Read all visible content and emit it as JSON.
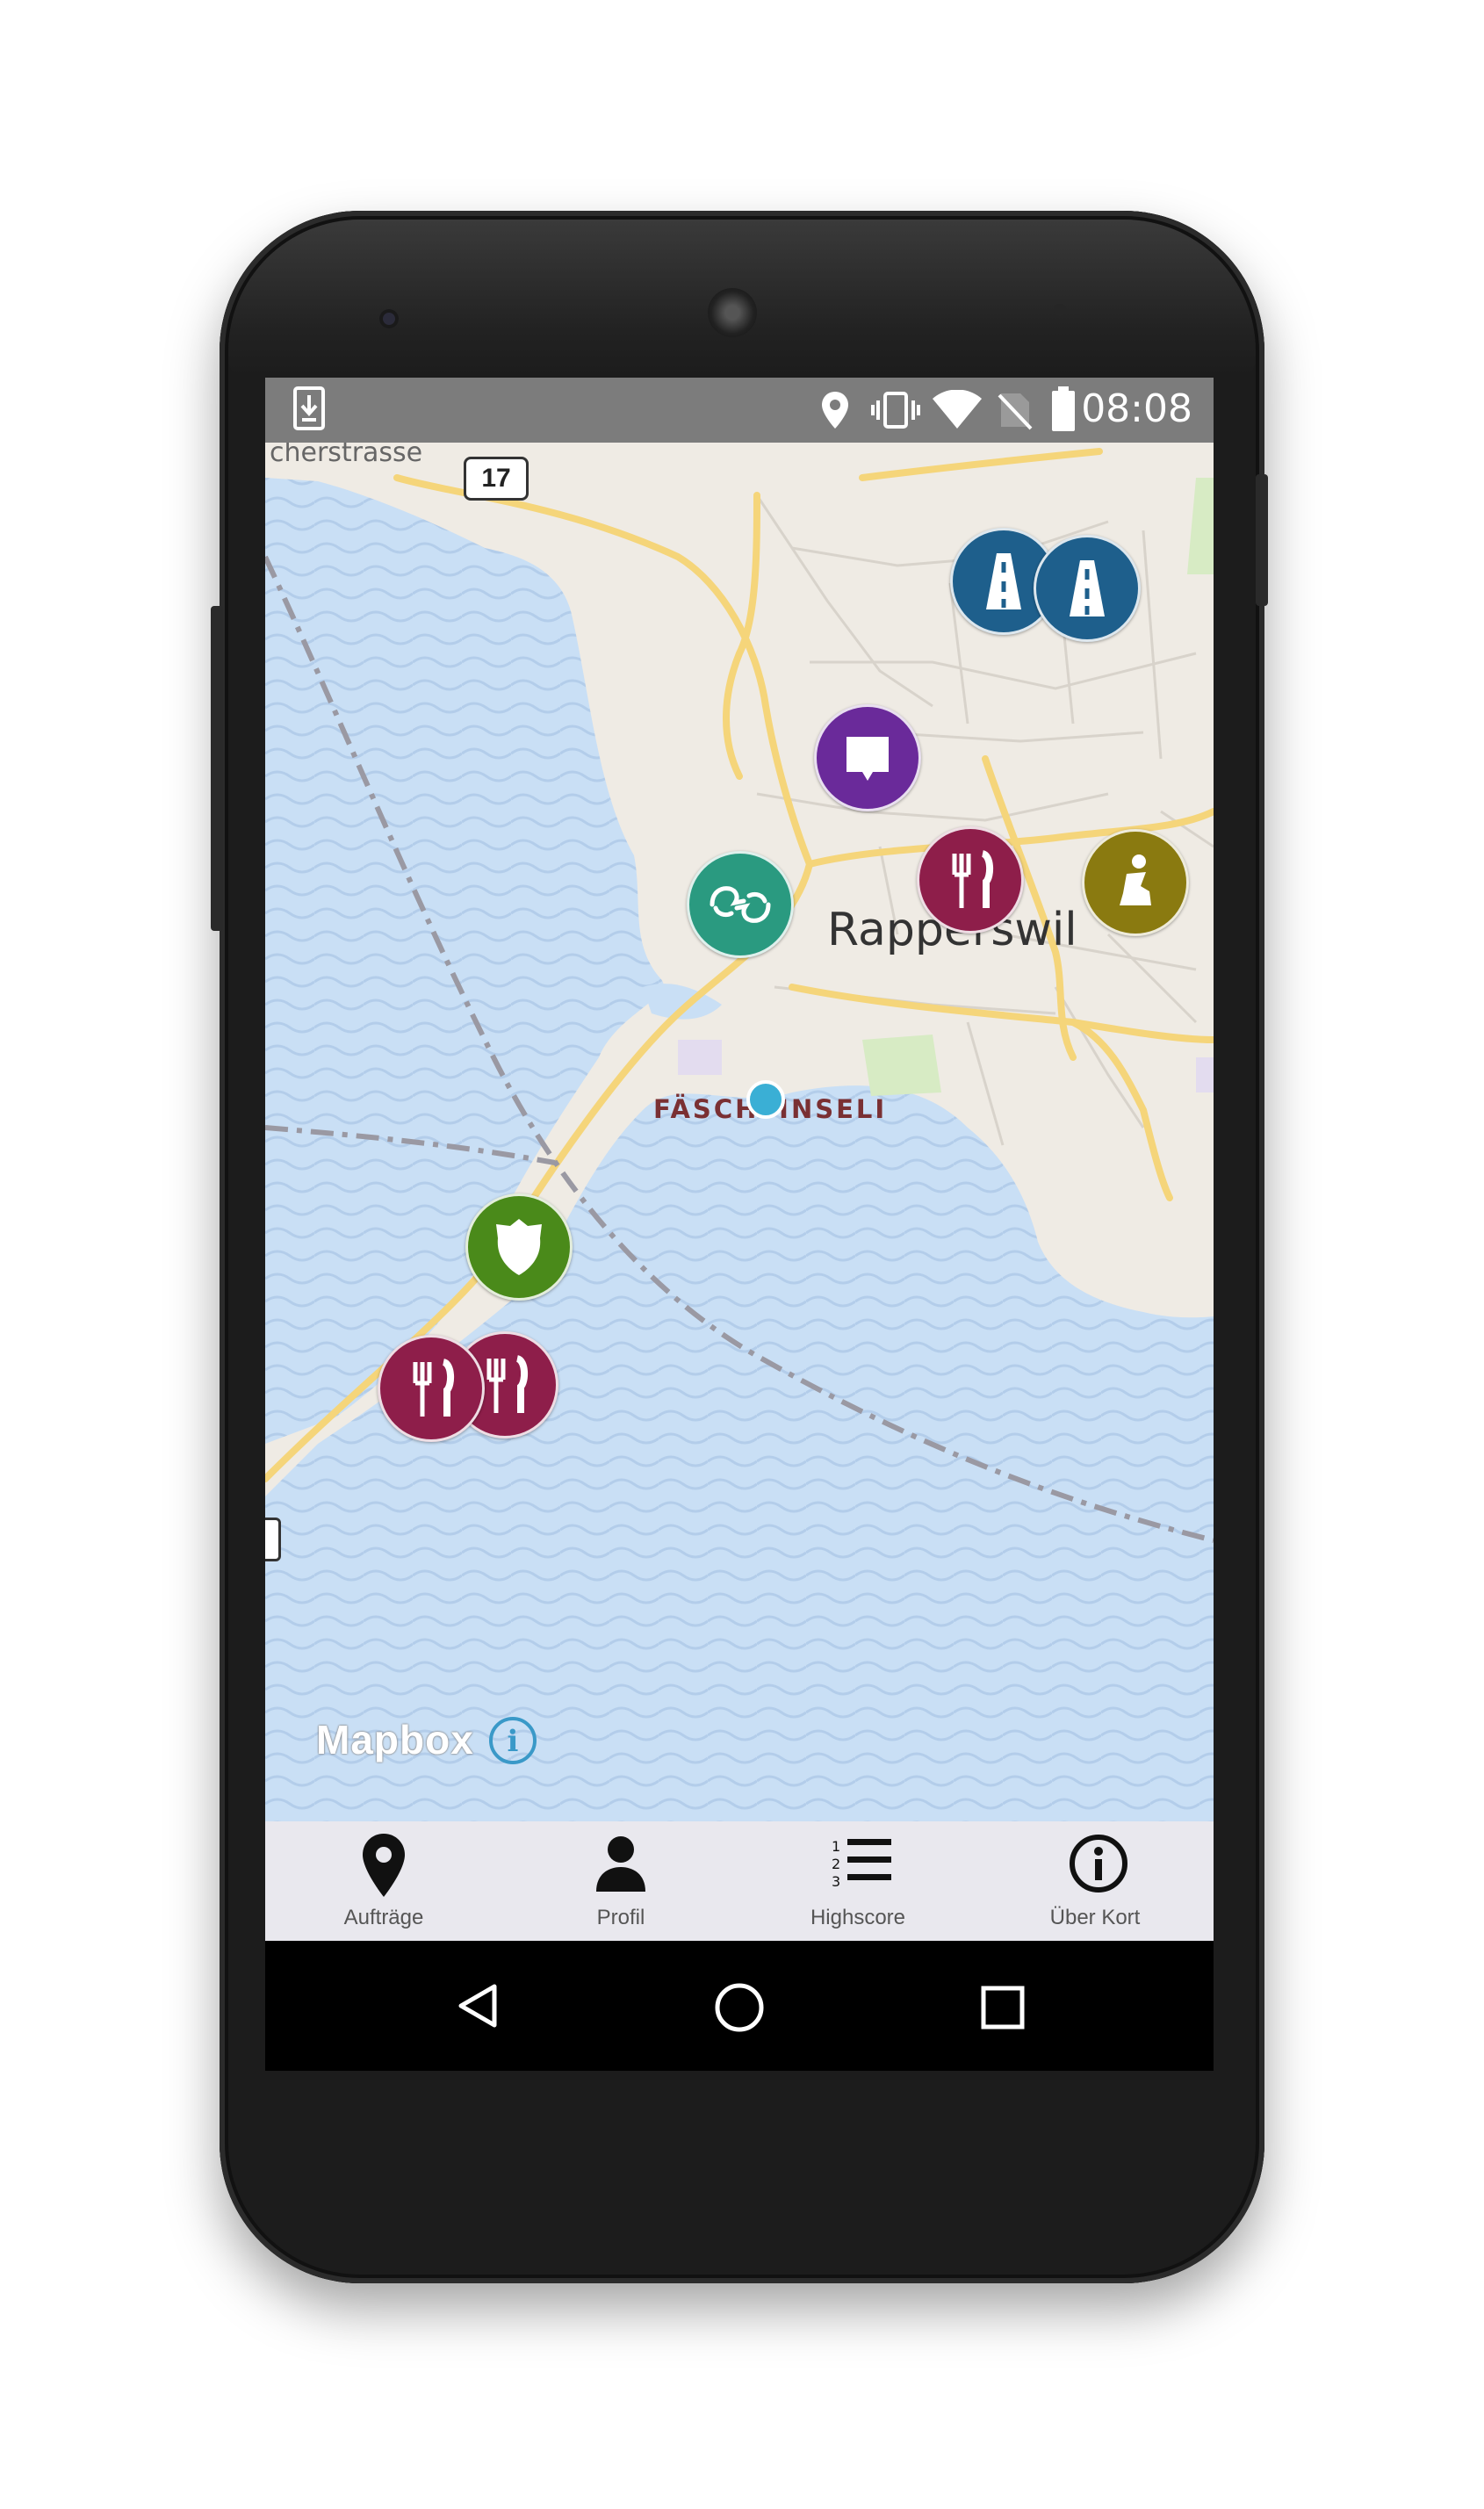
{
  "status_bar": {
    "time": "08:08",
    "icons": [
      "download-icon",
      "location-icon",
      "vibrate-icon",
      "wifi-icon",
      "no-sim-icon",
      "battery-icon"
    ]
  },
  "map": {
    "labels": {
      "city": "Rapperswil",
      "district": "FÄSCHTINSELI",
      "street": "cherstrasse",
      "route_number": "17"
    },
    "attribution": {
      "logo_text": "Mapbox",
      "info_symbol": "i"
    },
    "markers": [
      {
        "name": "road-mission-marker",
        "icon": "road-icon",
        "color": "#1e5f8c"
      },
      {
        "name": "road-mission-marker",
        "icon": "road-icon",
        "color": "#1e5f8c"
      },
      {
        "name": "comment-mission-marker",
        "icon": "speech-bubble-icon",
        "color": "#6a2a9a"
      },
      {
        "name": "sign-language-mission-marker",
        "icon": "sign-language-icon",
        "color": "#2a9a80"
      },
      {
        "name": "restaurant-mission-marker",
        "icon": "fork-knife-icon",
        "color": "#8e1e4a"
      },
      {
        "name": "worship-mission-marker",
        "icon": "praying-person-icon",
        "color": "#8a7a10"
      },
      {
        "name": "police-mission-marker",
        "icon": "police-badge-icon",
        "color": "#4a8a1a"
      },
      {
        "name": "restaurant-mission-marker",
        "icon": "fork-knife-icon",
        "color": "#8e1e4a"
      },
      {
        "name": "restaurant-mission-marker",
        "icon": "fork-knife-icon",
        "color": "#8e1e4a"
      }
    ],
    "colors": {
      "water": "#c9dff5",
      "land": "#efebe4",
      "road": "#f5d57a",
      "boundary": "#9a9a9a"
    }
  },
  "tabs": [
    {
      "label": "Aufträge",
      "icon": "map-pin-icon"
    },
    {
      "label": "Profil",
      "icon": "person-icon"
    },
    {
      "label": "Highscore",
      "icon": "ranked-list-icon"
    },
    {
      "label": "Über Kort",
      "icon": "info-circle-icon"
    }
  ],
  "nav_bar": {
    "buttons": [
      "back-icon",
      "home-icon",
      "recents-icon"
    ]
  }
}
